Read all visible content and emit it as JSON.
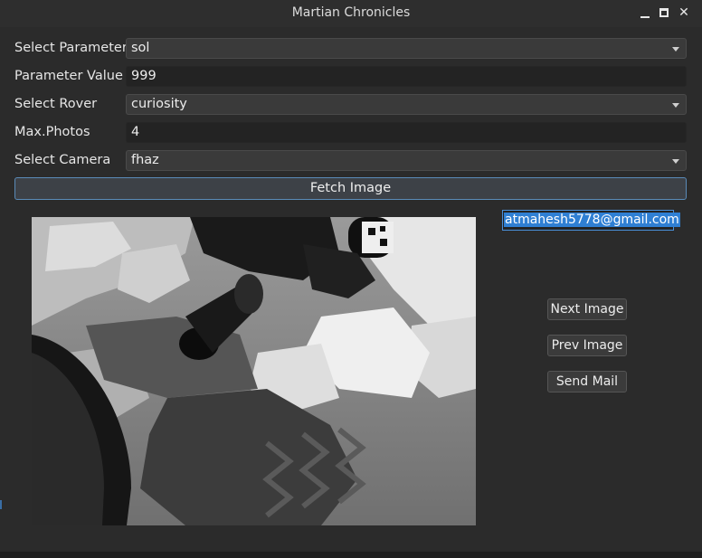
{
  "window": {
    "title": "Martian Chronicles",
    "controls": {
      "minimize_icon": "minimize-icon",
      "maximize_icon": "maximize-icon",
      "close_icon": "close-icon",
      "close_glyph": "✕"
    }
  },
  "form": {
    "parameter": {
      "label": "Select Parameter",
      "selected": "sol"
    },
    "parameter_value": {
      "label": "Parameter Value",
      "value": "999"
    },
    "rover": {
      "label": "Select Rover",
      "selected": "curiosity"
    },
    "max_photos": {
      "label": "Max.Photos",
      "value": "4"
    },
    "camera": {
      "label": "Select Camera",
      "selected": "fhaz"
    },
    "fetch_button": "Fetch Image"
  },
  "viewer": {
    "image_description": "Black and white Mars rover hazard camera photo showing rocky terrain, wheel and shadow"
  },
  "side": {
    "email": "atmahesh5778@gmail.com",
    "next_button": "Next Image",
    "prev_button": "Prev Image",
    "send_button": "Send Mail"
  },
  "colors": {
    "background": "#2b2b2b",
    "accent": "#4a90d9",
    "selection": "#2f7fd3"
  }
}
